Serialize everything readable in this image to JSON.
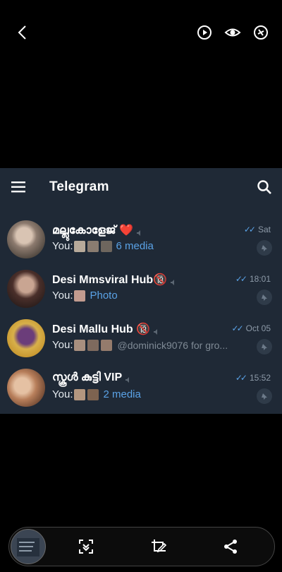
{
  "app": {
    "title": "Telegram"
  },
  "chats": [
    {
      "name": "മല്ലുകോളേജ് ❤️",
      "time": "Sat",
      "you": "You:",
      "text": "6 media",
      "text_style": "blue"
    },
    {
      "name": "Desi Mmsviral Hub🔞",
      "time": "18:01",
      "you": "You:",
      "text": "Photo",
      "text_style": "blue"
    },
    {
      "name": "Desi Mallu Hub 🔞",
      "time": "Oct 05",
      "you": "You:",
      "text": "@dominick9076 for gro...",
      "text_style": "grey"
    },
    {
      "name": "സ്കൂൾ കുട്ടി VIP",
      "time": "15:52",
      "you": "You:",
      "text": "2 media",
      "text_style": "blue"
    }
  ],
  "icons": {
    "back": "chevron-left-icon",
    "topbar": [
      "play-circle-icon",
      "eye-icon",
      "sync-icon"
    ],
    "bottombar": [
      "scroll-capture-icon",
      "crop-edit-icon",
      "share-icon"
    ]
  }
}
